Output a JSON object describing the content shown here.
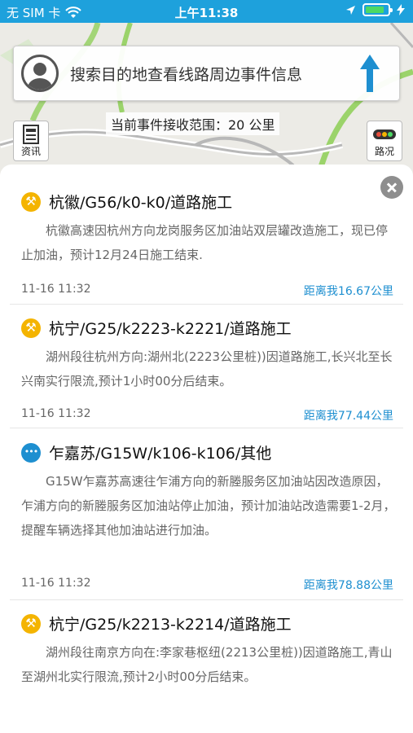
{
  "status_bar": {
    "carrier": "无 SIM 卡",
    "time": "上午11:38",
    "battery_level": 0.85
  },
  "search": {
    "placeholder_text": "搜索目的地查看线路周边事件信息"
  },
  "map": {
    "range_label": "当前事件接收范围：20 公里",
    "news_button": "资讯",
    "traffic_button": "路况",
    "road_colors": {
      "highway": "#9bd36a",
      "road": "#b8b8b8"
    }
  },
  "events": [
    {
      "icon": "construction-icon",
      "title": "杭徽/G56/k0-k0/道路施工",
      "description": "杭徽高速因杭州方向龙岗服务区加油站双层罐改造施工，现已停止加油，预计12月24日施工结束.",
      "time": "11-16 11:32",
      "distance": "距离我16.67公里"
    },
    {
      "icon": "construction-icon",
      "title": "杭宁/G25/k2223-k2221/道路施工",
      "description": "湖州段往杭州方向:湖州北(2223公里桩))因道路施工,长兴北至长兴南实行限流,预计1小时00分后结束。",
      "time": "11-16 11:32",
      "distance": "距离我77.44公里"
    },
    {
      "icon": "more-icon",
      "title": "乍嘉苏/G15W/k106-k106/其他",
      "description": "G15W乍嘉苏高速往乍浦方向的新塍服务区加油站因改造原因，乍浦方向的新塍服务区加油站停止加油，预计加油站改造需要1-2月，提醒车辆选择其他加油站进行加油。",
      "time": "11-16 11:32",
      "distance": "距离我78.88公里"
    },
    {
      "icon": "construction-icon",
      "title": "杭宁/G25/k2213-k2214/道路施工",
      "description": "湖州段往南京方向在:李家巷枢纽(2213公里桩))因道路施工,青山至湖州北实行限流,预计2小时00分后结束。",
      "time": "",
      "distance": ""
    }
  ]
}
